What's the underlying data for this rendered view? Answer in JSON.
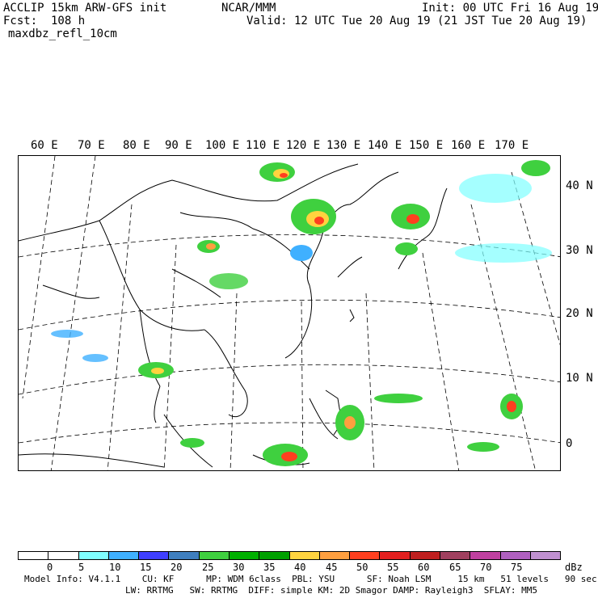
{
  "header": {
    "left_line1": "ACCLIP 15km ARW-GFS init",
    "left_line2": "Fcst:  108 h",
    "left_line3": "maxdbz_refl_10cm",
    "center": "NCAR/MMM",
    "right_line1": "Init: 00 UTC Fri 16 Aug 19",
    "right_line2": "Valid: 12 UTC Tue 20 Aug 19 (21 JST Tue 20 Aug 19)"
  },
  "longitude_labels": [
    "60 E",
    "70 E",
    "80 E",
    "90 E",
    "100 E",
    "110 E",
    "120 E",
    "130 E",
    "140 E",
    "150 E",
    "160 E",
    "170 E"
  ],
  "latitude_labels": [
    "40 N",
    "30 N",
    "20 N",
    "10 N",
    "0"
  ],
  "colorbar": {
    "unit": "dBz",
    "ticks": [
      "0",
      "5",
      "10",
      "15",
      "20",
      "25",
      "30",
      "35",
      "40",
      "45",
      "50",
      "55",
      "60",
      "65",
      "70",
      "75"
    ],
    "colors": [
      "#ffffff",
      "#ffffff",
      "#7fffff",
      "#3fb0ff",
      "#3f3fff",
      "#3f7fbf",
      "#3fd03f",
      "#00b000",
      "#00a000",
      "#ffd33f",
      "#ff9f3f",
      "#ff3f1f",
      "#e31f1f",
      "#bf1f1f",
      "#a0405f",
      "#c040a0",
      "#b060c0",
      "#c090d0"
    ]
  },
  "footer": {
    "line1": "Model Info: V4.1.1    CU: KF      MP: WDM 6class  PBL: YSU      SF: Noah LSM     15 km   51 levels   90 sec",
    "line2": "LW: RRTMG   SW: RRTMG  DIFF: simple KM: 2D Smagor DAMP: Rayleigh3  SFLAY: MM5"
  }
}
